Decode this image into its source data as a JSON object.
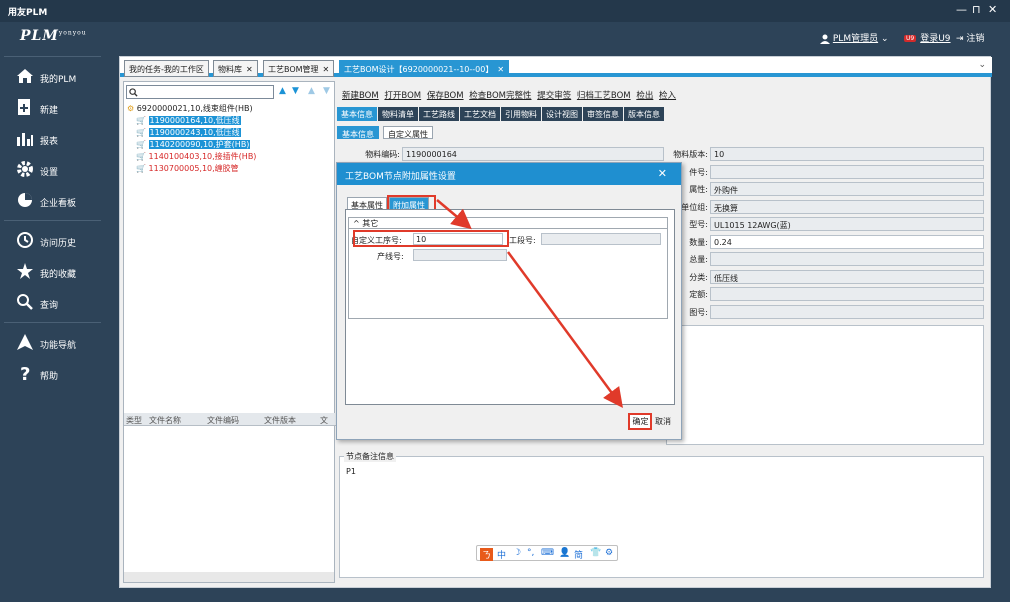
{
  "window": {
    "title": "用友PLM",
    "minimize": "—",
    "maximize": "⊓",
    "close": "✕"
  },
  "header": {
    "logo": "PLM",
    "logo_sup": "yonyou",
    "user": "PLM管理员",
    "u9_badge": "U9",
    "login_u9": "登录U9",
    "logout": "注销"
  },
  "sidebar": {
    "items": [
      {
        "label": "我的PLM",
        "icon": "home-icon"
      },
      {
        "label": "新建",
        "icon": "new-document-icon"
      },
      {
        "label": "报表",
        "icon": "bar-chart-icon"
      },
      {
        "label": "设置",
        "icon": "gear-icon"
      },
      {
        "label": "企业看板",
        "icon": "pie-chart-icon"
      },
      {
        "label": "访问历史",
        "icon": "history-icon"
      },
      {
        "label": "我的收藏",
        "icon": "star-icon"
      },
      {
        "label": "查询",
        "icon": "search-icon"
      },
      {
        "label": "功能导航",
        "icon": "navigation-arrow-icon"
      },
      {
        "label": "帮助",
        "icon": "question-icon"
      }
    ]
  },
  "tabs": [
    {
      "label": "我的任务-我的工作区"
    },
    {
      "label": "物料库",
      "close": "✕"
    },
    {
      "label": "工艺BOM管理",
      "close": "✕"
    },
    {
      "label": "工艺BOM设计【6920000021--10--00】",
      "close": "✕"
    }
  ],
  "tree": {
    "search_placeholder": "",
    "root": "6920000021,10,线束组件(HB)",
    "children": [
      {
        "label": "1190000164,10,低压线"
      },
      {
        "label": "1190000243,10,低压线"
      },
      {
        "label": "1140200090,10,护套(HB)"
      },
      {
        "label": "1140100403,10,接插件(HB)"
      },
      {
        "label": "1130700005,10,缠胶管"
      }
    ]
  },
  "doc_grid": {
    "columns": [
      "类型",
      "文件名称",
      "文件编码",
      "文件版本",
      "文"
    ]
  },
  "toolbar": {
    "items": [
      "新建BOM",
      "打开BOM",
      "保存BOM",
      "检查BOM完整性",
      "提交审签",
      "归档工艺BOM",
      "检出",
      "检入"
    ]
  },
  "subtabs": {
    "items": [
      "基本信息",
      "物料清单",
      "工艺路线",
      "工艺文档",
      "引用物料",
      "设计视图",
      "审签信息",
      "版本信息"
    ],
    "inner": [
      "基本信息",
      "自定义属性"
    ]
  },
  "props": {
    "material_code_label": "物料编码:",
    "material_code": "1190000164",
    "rows": [
      {
        "label": "物料版本:",
        "value": "10"
      },
      {
        "label": "件号:",
        "value": ""
      },
      {
        "label": "属性:",
        "value": "外购件"
      },
      {
        "label": "单位组:",
        "value": "无换算"
      },
      {
        "label": "型号:",
        "value": "UL1015 12AWG(蓝)"
      },
      {
        "label": "数量:",
        "value": "0.24"
      },
      {
        "label": "总量:",
        "value": ""
      },
      {
        "label": "分类:",
        "value": "低压线"
      },
      {
        "label": "定额:",
        "value": ""
      },
      {
        "label": "图号:",
        "value": ""
      }
    ]
  },
  "notes": {
    "legend": "节点备注信息",
    "text": "P1"
  },
  "dialog": {
    "title": "工艺BOM节点附加属性设置",
    "close": "✕",
    "tabs": [
      "基本属性",
      "附加属性"
    ],
    "section": "其它",
    "section_toggle": "^",
    "custom_process_label": "自定义工序号:",
    "custom_process_value": "10",
    "segment_label": "工段号:",
    "segment_value": "",
    "line_label": "产线号:",
    "line_value": "",
    "ok": "确定",
    "cancel": "取消"
  },
  "ime": {
    "items": [
      "中",
      "☽",
      "°,",
      "⌨",
      "👤",
      "简",
      "👕",
      "⚙"
    ]
  },
  "accent_color": "#2896d3",
  "annotation_color": "#e03a2a"
}
